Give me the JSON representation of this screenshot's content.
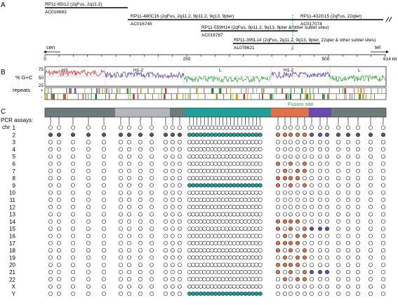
{
  "panels": {
    "a": "A",
    "b": "B",
    "c": "C"
  },
  "clones": [
    {
      "name": "RP11-65I12 (2qFus, 2q11.2)",
      "acc": "AC016683"
    },
    {
      "name": "RP11-480C16 (2qFus, 2q11.2, 9p11.2, 9q13, 9pter)",
      "acc": "AC016745"
    },
    {
      "name": "RP11-432G15 (2qFus, 22qter)",
      "acc": "AC017074"
    },
    {
      "name": "RP11-559H14 (2qFus, 9p11.2, 9q13, 9pter & other subtel sites)",
      "acc": "AC016767"
    },
    {
      "name": "RP11-395L14 (2qFus, 2q11.2, 9q13, 9pter, 22qter & other subtel sites)",
      "acc": "AL078621"
    }
  ],
  "fusion_marker": "F",
  "axis": {
    "cen": "cen",
    "tel": "tel",
    "ticks": [
      "0",
      "250",
      "500"
    ],
    "end": "614 kb"
  },
  "gc": {
    "label": "% G+C",
    "ticks": [
      "75",
      "50",
      "25"
    ],
    "isochores": [
      "H3",
      "H1-2",
      "L",
      "H1-2",
      "L"
    ]
  },
  "repeats": {
    "label": "repeats",
    "plus": "+",
    "minus": "-"
  },
  "fusion_site": "Fusion site",
  "pcr": {
    "label": "PCR assays:",
    "chr_label": "chr",
    "chromosomes": [
      "1",
      "2",
      "3",
      "4",
      "5",
      "6",
      "7",
      "8",
      "9",
      "10",
      "11",
      "12",
      "13",
      "14",
      "15",
      "16",
      "17",
      "18",
      "19",
      "20",
      "21",
      "22",
      "X",
      "Y"
    ]
  },
  "colors": {
    "h3": "#d62020",
    "h12": "#5a3aa0",
    "l": "#2f9a3a",
    "teal": "#1f9e9a",
    "orange": "#e0724a",
    "purple": "#6a4ab0",
    "grey_dark": "#6d7b7b",
    "grey_light": "#b5b5bd"
  }
}
